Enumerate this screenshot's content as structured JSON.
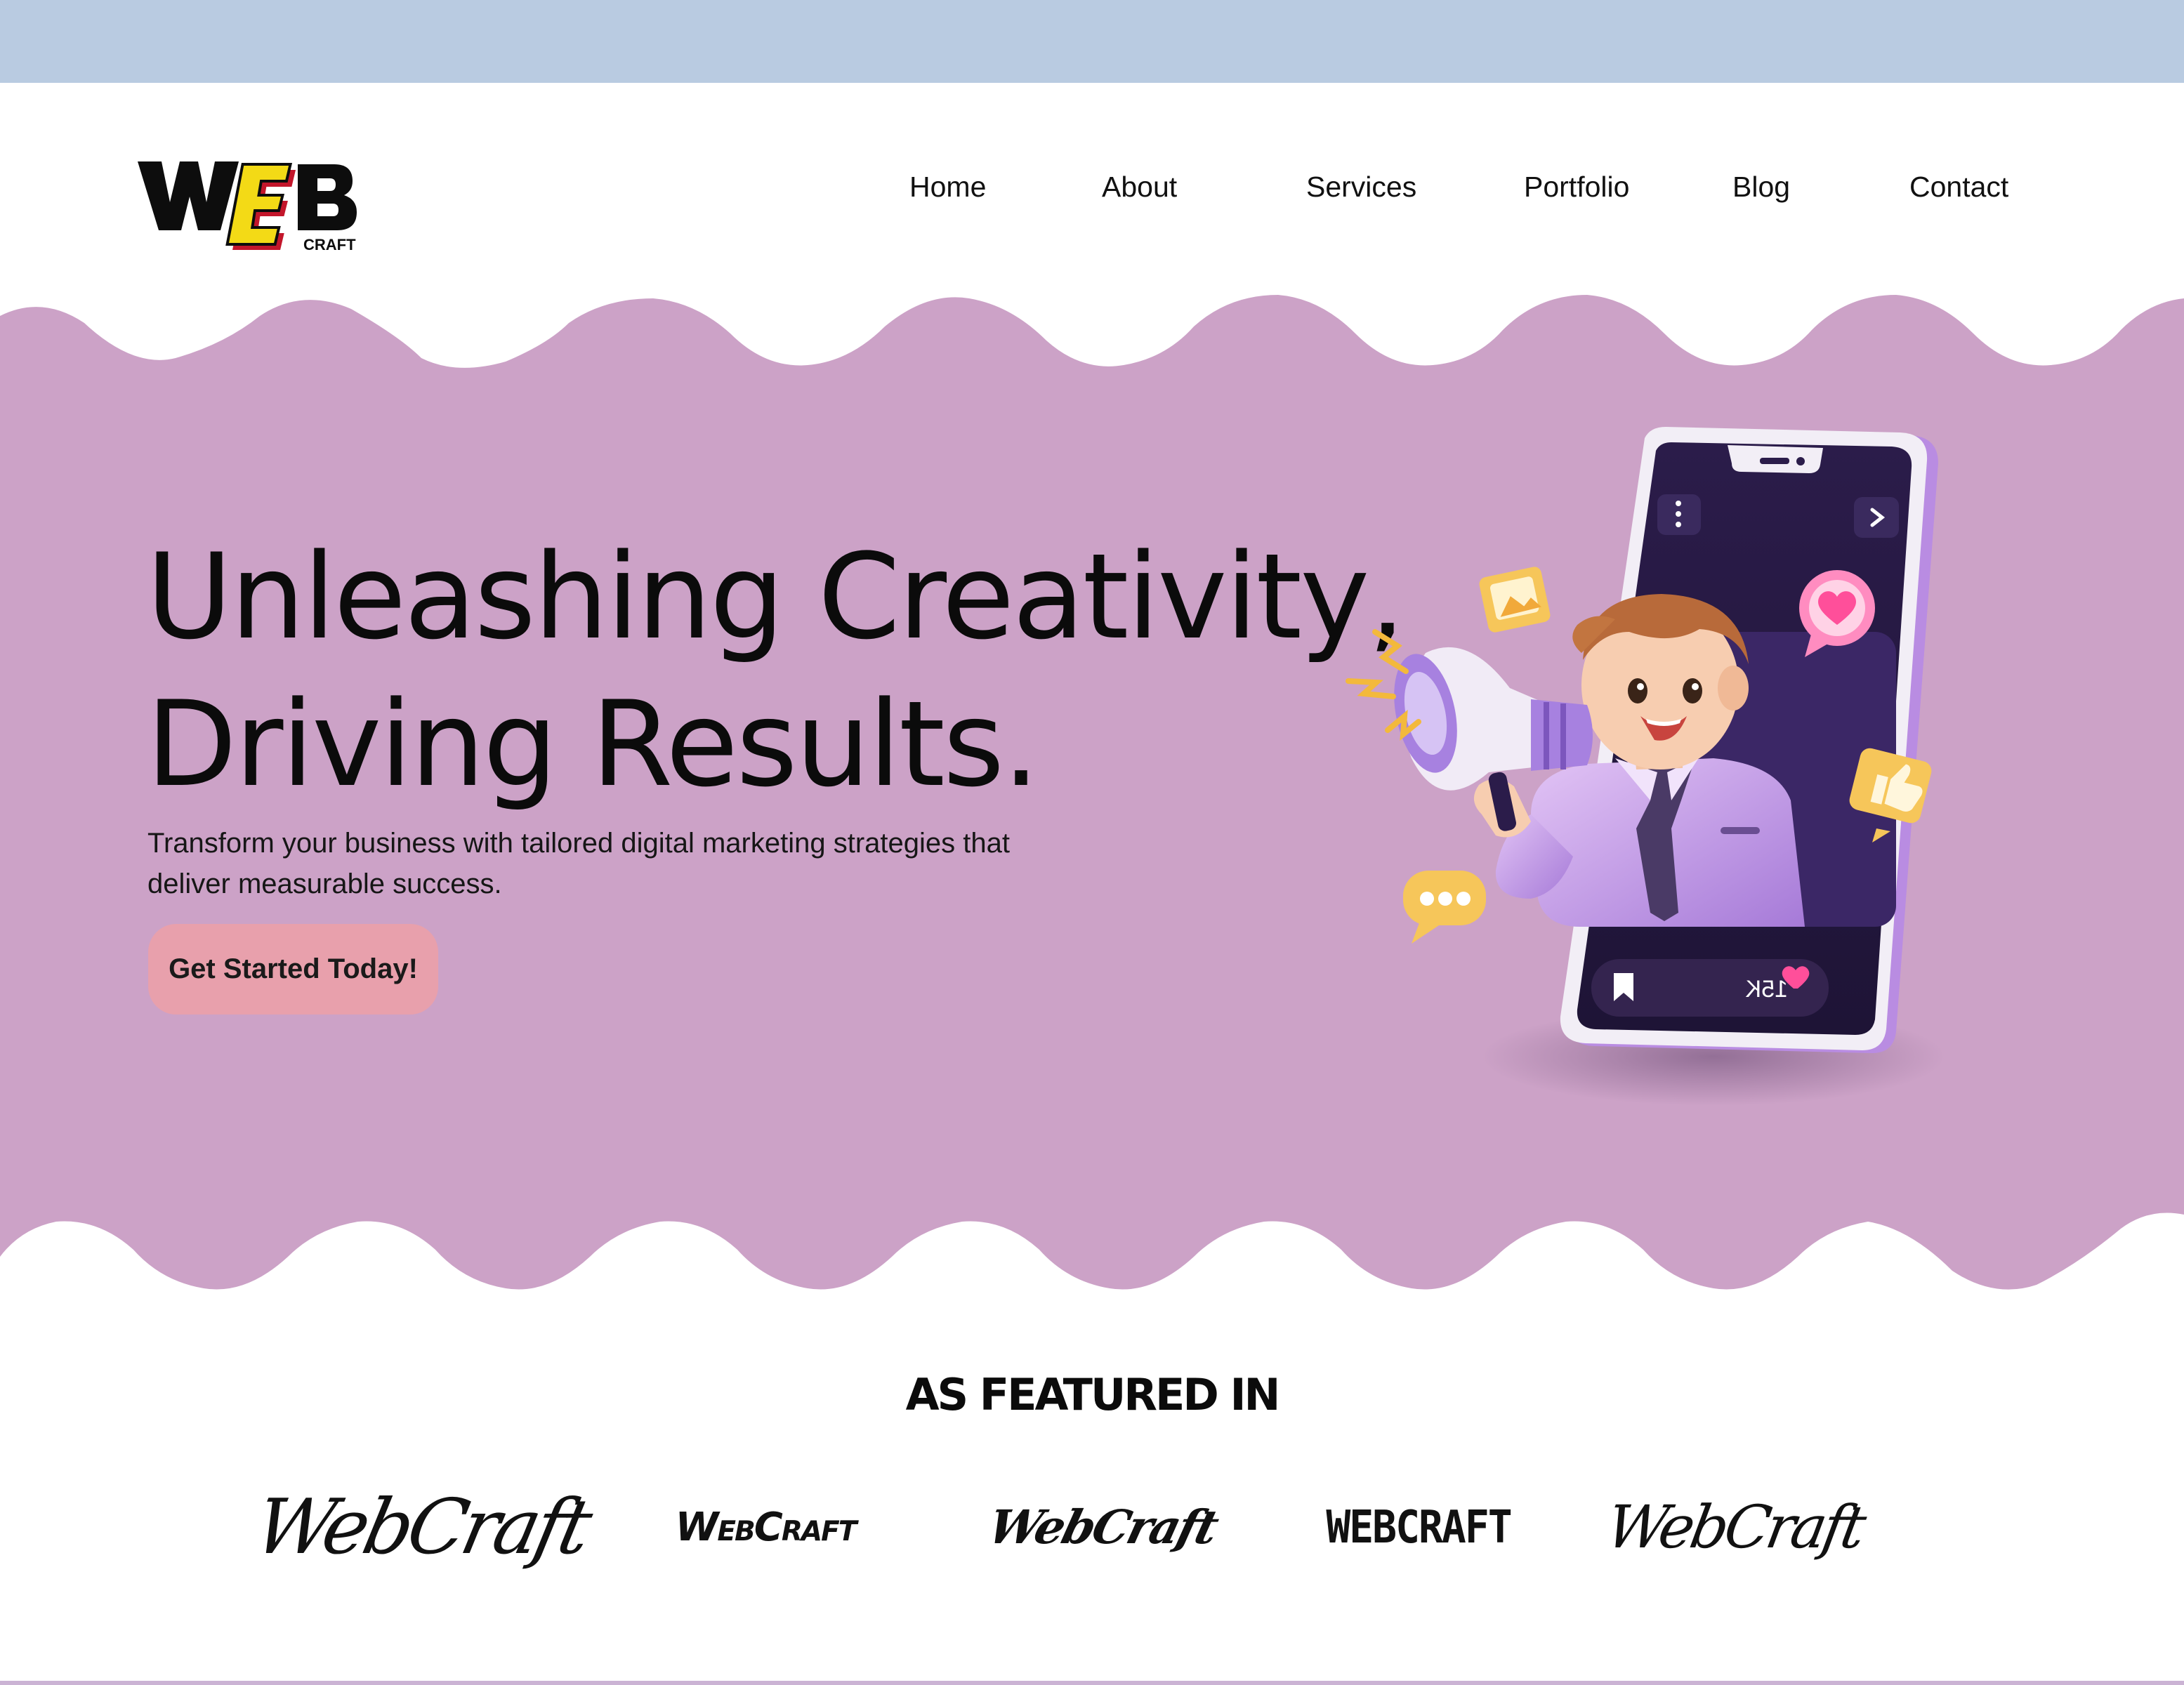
{
  "header": {
    "logo": {
      "main": "WEB",
      "sub": "CRAFT"
    },
    "nav": [
      "Home",
      "About",
      "Services",
      "Portfolio",
      "Blog",
      "Contact"
    ]
  },
  "hero": {
    "headline_line1": "Unleashing Creativity,",
    "headline_line2": "Driving Results.",
    "subtext_line1": "Transform your business with tailored digital marketing strategies that",
    "subtext_line2": "deliver measurable success.",
    "cta_label": "Get Started Today!",
    "phone_count": "15K"
  },
  "featured": {
    "title": "AS FEATURED IN",
    "brands": [
      "WebCraft",
      "WebCraft",
      "WebCraft",
      "WEBCRAFT",
      "WebCraft"
    ]
  },
  "colors": {
    "top_strip": "#b9cbe1",
    "hero_bg": "#cca2c7",
    "cta_bg": "#e8a0ac",
    "accent_purple": "#9b6fd6"
  },
  "icons": [
    "megaphone-icon",
    "heart-icon",
    "thumbs-up-icon",
    "chat-bubble-icon",
    "image-icon",
    "bookmark-icon",
    "menu-dots-icon",
    "chevron-right-icon"
  ]
}
